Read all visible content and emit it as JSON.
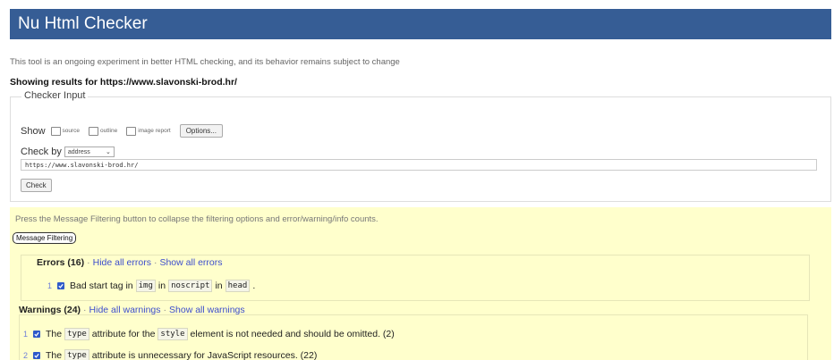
{
  "header": {
    "title": "Nu Html Checker"
  },
  "tagline": "This tool is an ongoing experiment in better HTML checking, and its behavior remains subject to change",
  "showing": "Showing results for https://www.slavonski-brod.hr/",
  "checker_input": {
    "legend": "Checker Input",
    "show_label": "Show",
    "options": {
      "source": "source",
      "outline": "outline",
      "image_report": "image report"
    },
    "options_button": "Options...",
    "check_by_label": "Check by",
    "check_by_value": "address",
    "url_value": "https://www.slavonski-brod.hr/",
    "check_button": "Check"
  },
  "filter": {
    "press_text": "Press the Message Filtering button to collapse the filtering options and error/warning/info counts.",
    "button": "Message Filtering"
  },
  "errors": {
    "title": "Errors (16)",
    "sep": "·",
    "hide_all": "Hide all errors",
    "show_all": "Show all errors",
    "items": [
      {
        "num": "1",
        "t1": "Bad start tag in",
        "c1": "img",
        "t2": "in",
        "c2": "noscript",
        "t3": "in",
        "c3": "head",
        "t4": "."
      }
    ]
  },
  "warnings": {
    "title": "Warnings (24)",
    "sep": "·",
    "hide_all": "Hide all warnings",
    "show_all": "Show all warnings",
    "items": [
      {
        "num": "1",
        "t1": "The",
        "c1": "type",
        "t2": "attribute for the",
        "c2": "style",
        "t3": "element is not needed and should be omitted. (2)"
      },
      {
        "num": "2",
        "t1": "The",
        "c1": "type",
        "t2": "attribute is unnecessary for JavaScript resources. (22)"
      }
    ]
  },
  "colors": {
    "title_bar": "#365d95",
    "filter_bg": "#ffffcc",
    "link": "#3d4ecc",
    "checkbox_checked": "#2f5ac9"
  }
}
